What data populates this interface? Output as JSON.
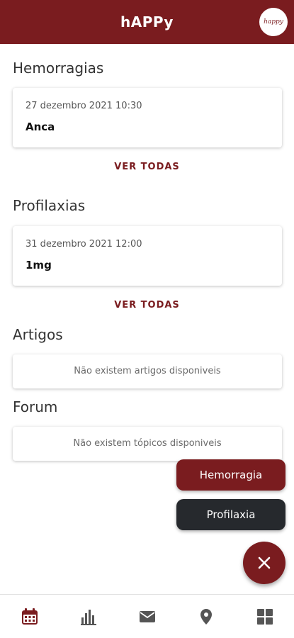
{
  "app": {
    "title": "hAPPy",
    "avatar_text": "happy"
  },
  "hemorragias": {
    "title": "Hemorragias",
    "items": [
      {
        "date": "27 dezembro 2021 10:30",
        "value": "Anca"
      }
    ],
    "see_all": "VER TODAS"
  },
  "profilaxias": {
    "title": "Profilaxias",
    "items": [
      {
        "date": "31 dezembro 2021 12:00",
        "value": "1mg"
      }
    ],
    "see_all": "VER TODAS"
  },
  "artigos": {
    "title": "Artigos",
    "empty": "Não existem artigos disponiveis"
  },
  "forum": {
    "title": "Forum",
    "empty": "Não existem tópicos disponiveis"
  },
  "fab": {
    "hemorragia": "Hemorragia",
    "profilaxia": "Profilaxia",
    "close_icon": "close-icon"
  },
  "nav": {
    "items": [
      {
        "icon": "calendar-icon",
        "active": true
      },
      {
        "icon": "bar-chart-icon",
        "active": false
      },
      {
        "icon": "mail-icon",
        "active": false
      },
      {
        "icon": "location-pin-icon",
        "active": false
      },
      {
        "icon": "grid-icon",
        "active": false
      }
    ]
  },
  "colors": {
    "primary": "#7a1c1f",
    "dark": "#26292d",
    "nav_inactive": "#555555"
  }
}
